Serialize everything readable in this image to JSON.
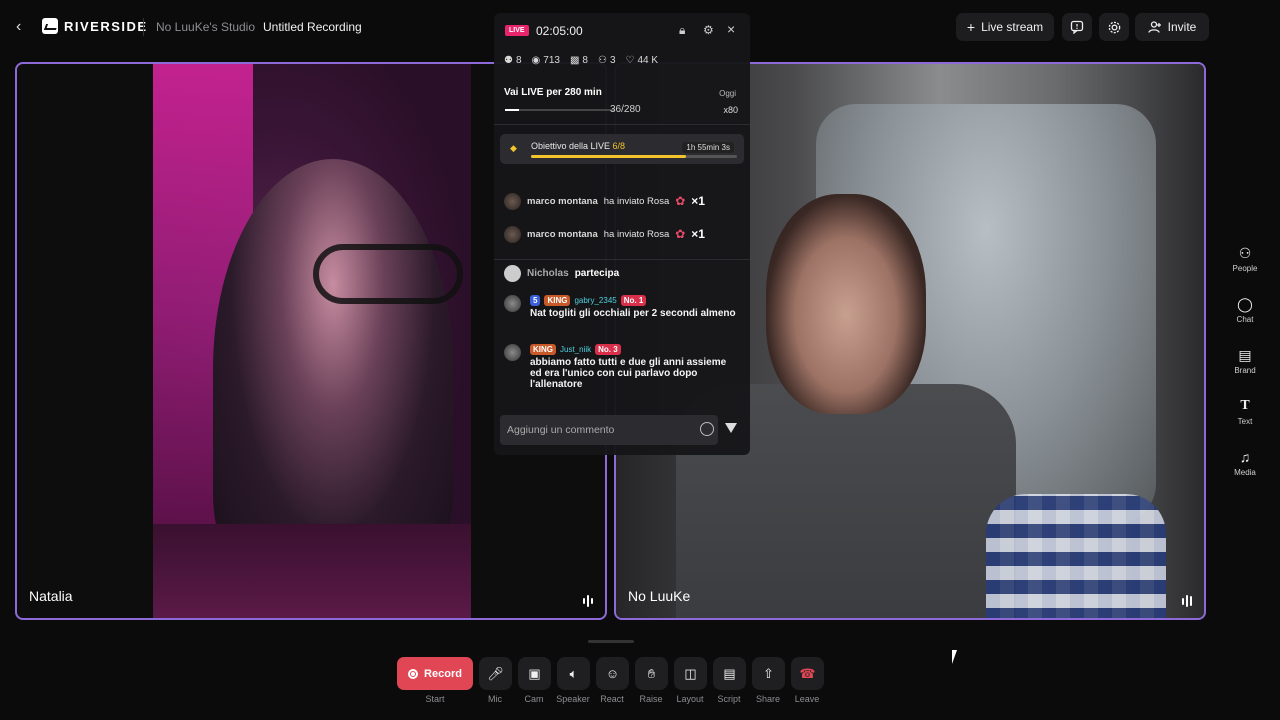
{
  "topbar": {
    "brand": "RIVERSIDE",
    "studio": "No LuuKe's Studio",
    "recording_title": "Untitled Recording",
    "live_stream_label": "Live stream",
    "invite_label": "Invite"
  },
  "tiles": [
    {
      "name": "Natalia"
    },
    {
      "name": "No LuuKe"
    }
  ],
  "live": {
    "badge": "LIVE",
    "time": "02:05:00",
    "stats": {
      "guests": "8",
      "views": "713",
      "gifts": "8",
      "joins": "3",
      "likes": "44 K"
    },
    "goal_title": "Vai LIVE per 280 min",
    "goal_count": "36/280",
    "oggi": "Oggi",
    "multiplier": "x80",
    "objective_prefix": "Obiettivo della LIVE ",
    "objective_value": "6/8",
    "objective_time": "1h 55min 3s",
    "objective_progress": 0.75,
    "gifts": [
      {
        "user": "marco montana",
        "action": "ha inviato Rosa",
        "count": "×1"
      },
      {
        "user": "marco montana",
        "action": "ha inviato Rosa",
        "count": "×1"
      }
    ],
    "join": {
      "user": "Nicholas",
      "action": "partecipa"
    },
    "comments": [
      {
        "badges": [
          "5",
          "KING"
        ],
        "user": "gabry_2345",
        "rank": "No. 1",
        "text": "Nat togliti gli occhiali per 2 secondi almeno"
      },
      {
        "badges": [
          "KING"
        ],
        "user": "Just_niik",
        "rank": "No. 3",
        "text": "abbiamo fatto tutti e due gli anni assieme ed era l'unico con cui parlavo dopo l'allenatore"
      }
    ],
    "input_placeholder": "Aggiungi un commento"
  },
  "sidebar": [
    {
      "label": "People",
      "icon": "people-icon"
    },
    {
      "label": "Chat",
      "icon": "chat-icon"
    },
    {
      "label": "Brand",
      "icon": "brand-icon"
    },
    {
      "label": "Text",
      "icon": "text-icon"
    },
    {
      "label": "Media",
      "icon": "music-icon"
    }
  ],
  "controls": {
    "record_label": "Record",
    "start_label": "Start",
    "items": [
      {
        "label": "Mic",
        "icon": "mic-icon"
      },
      {
        "label": "Cam",
        "icon": "camera-icon"
      },
      {
        "label": "Speaker",
        "icon": "speaker-icon"
      },
      {
        "label": "React",
        "icon": "react-icon"
      },
      {
        "label": "Raise",
        "icon": "hand-icon"
      },
      {
        "label": "Layout",
        "icon": "layout-icon"
      },
      {
        "label": "Script",
        "icon": "script-icon"
      },
      {
        "label": "Share",
        "icon": "share-icon"
      },
      {
        "label": "Leave",
        "icon": "leave-icon"
      }
    ]
  },
  "colors": {
    "accent": "#8e6ad8",
    "record": "#e14655",
    "live": "#e8246a",
    "objective": "#f3c42c"
  }
}
